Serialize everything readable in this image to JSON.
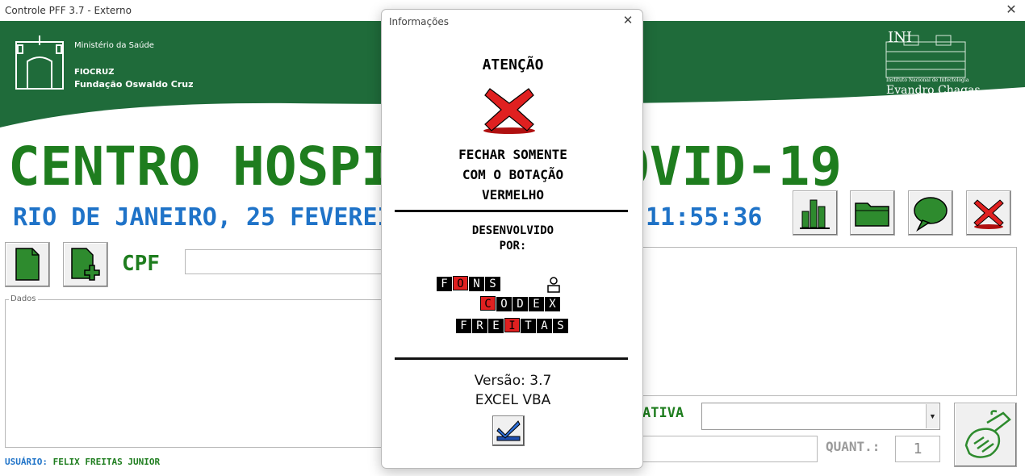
{
  "window": {
    "title": "Controle PFF 3.7 - Externo",
    "close_glyph": "✕"
  },
  "banner": {
    "ministry": "Ministério da Saúde",
    "fiocruz": "FIOCRUZ",
    "fundacao": "Fundação Oswaldo Cruz",
    "ini_abbr": "INI",
    "ini_full": "Instituto Nacional de Infectologia",
    "ini_name": "Evandro Chagas",
    "green": "#1f6b3a"
  },
  "header": {
    "title": "CENTRO HOSPITALAR COVID-19",
    "subtitle": "RIO DE JANEIRO, 25 FEVEREIRO 2021",
    "clock": "11:55:36"
  },
  "toolbar": {
    "icons": [
      "chart-icon",
      "folder-icon",
      "chat-icon",
      "close-red-icon"
    ]
  },
  "form": {
    "cpf_label": "CPF",
    "cpf_value": "",
    "dados_label": "Dados",
    "ativa_label": "ATIVA",
    "ativa_value": "",
    "bottom_value": "",
    "quant_label": "QUANT.:",
    "quant_value": "1"
  },
  "status": {
    "user_key": "USUÁRIO:",
    "user_name": "FELIX FREITAS JUNIOR"
  },
  "modal": {
    "title": "Informações",
    "close_glyph": "✕",
    "attention": "ATENÇÃO",
    "message_lines": [
      "FECHAR SOMENTE",
      "COM O BOTAÇÃO",
      "VERMELHO"
    ],
    "developed_lines": [
      "DESENVOLVIDO",
      "POR:"
    ],
    "logo_rows": [
      [
        "F",
        "O",
        "N",
        "S"
      ],
      [
        "C",
        "O",
        "D",
        "E",
        "X"
      ],
      [
        "F",
        "R",
        "E",
        "I",
        "T",
        "A",
        "S"
      ]
    ],
    "version": "Versão: 3.7",
    "platform": "EXCEL VBA"
  },
  "colors": {
    "green": "#1e7d1e",
    "blue": "#1f73c8",
    "red": "#e02020"
  }
}
